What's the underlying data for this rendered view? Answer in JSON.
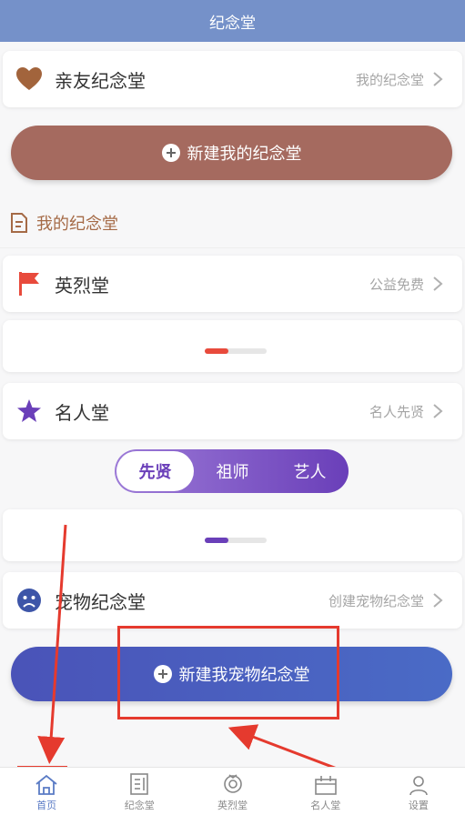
{
  "header": {
    "title": "纪念堂"
  },
  "family": {
    "title": "亲友纪念堂",
    "right": "我的纪念堂"
  },
  "new_button": {
    "label": "新建我的纪念堂"
  },
  "section": {
    "title": "我的纪念堂"
  },
  "martyrs": {
    "title": "英烈堂",
    "right": "公益免费"
  },
  "celebrity": {
    "title": "名人堂",
    "right": "名人先贤"
  },
  "segments": [
    "先贤",
    "祖师",
    "艺人"
  ],
  "pets": {
    "title": "宠物纪念堂",
    "right": "创建宠物纪念堂"
  },
  "new_pet_button": {
    "label": "新建我宠物纪念堂"
  },
  "tabs": [
    "首页",
    "纪念堂",
    "英烈堂",
    "名人堂",
    "设置"
  ],
  "colors": {
    "header": "#7591c9",
    "brown_button": "#a56a5f",
    "blue_button": "#4a63c0",
    "accent_purple": "#6a3fb9",
    "annotation_red": "#e53a2e"
  }
}
